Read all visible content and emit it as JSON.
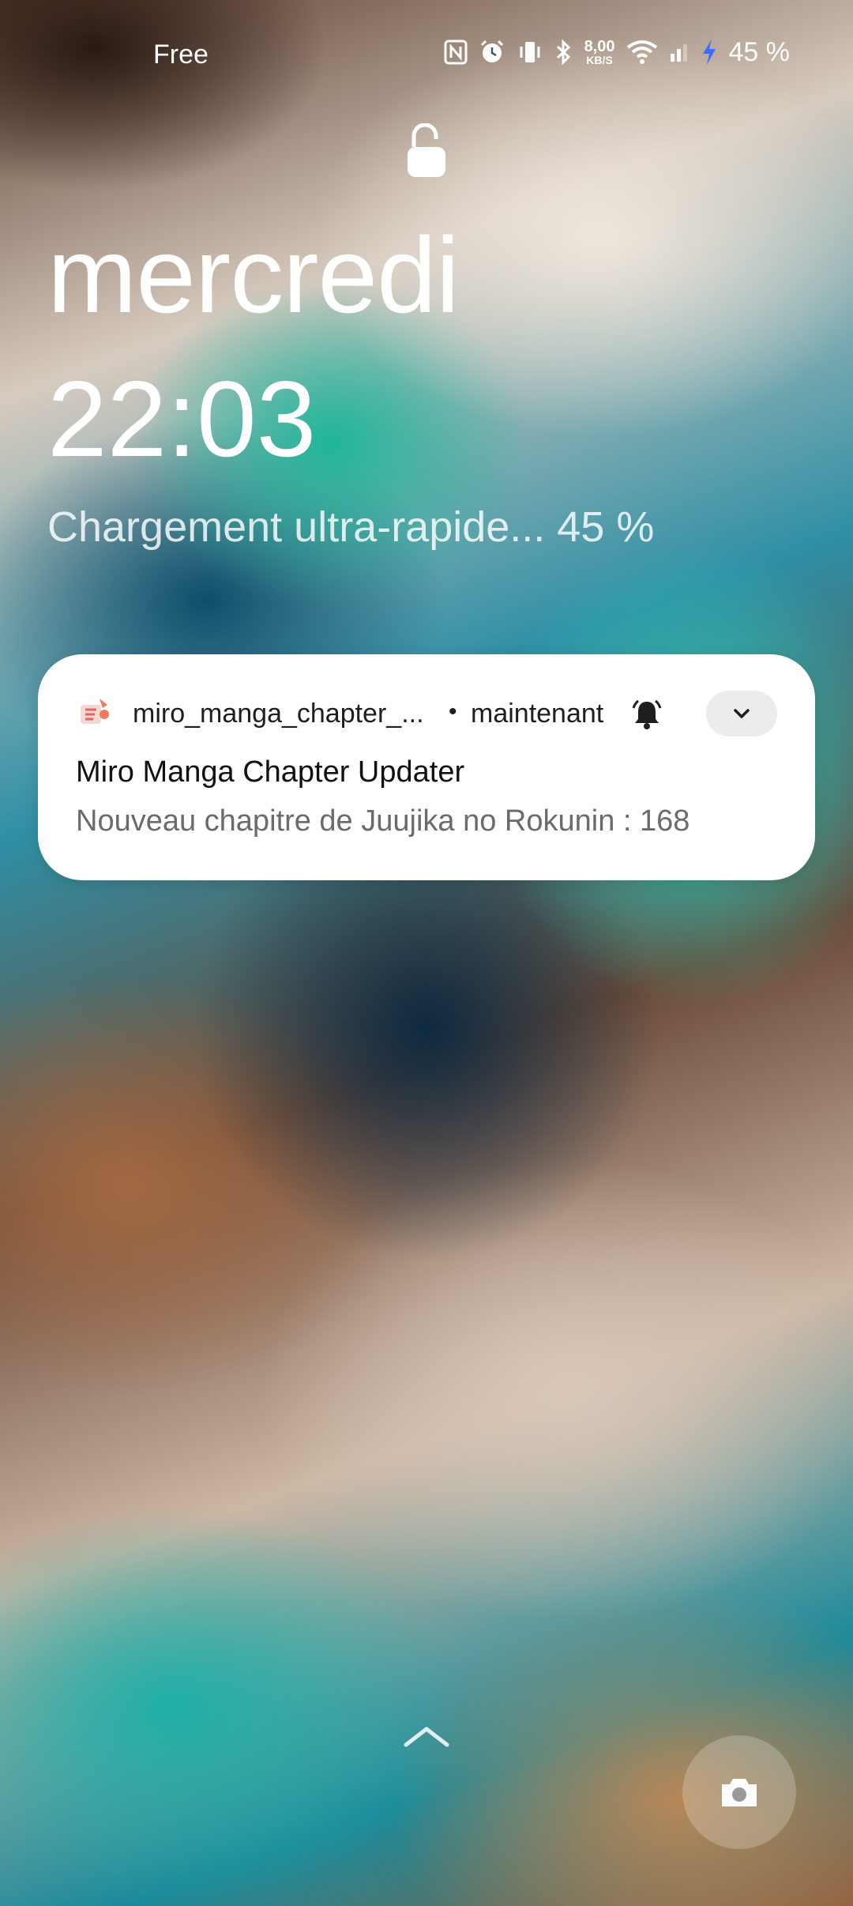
{
  "status_bar": {
    "carrier": "Free",
    "network_speed_value": "8,00",
    "network_speed_unit": "KB/S",
    "battery_percent": "45 %",
    "icons": [
      "nfc-icon",
      "alarm-icon",
      "vibrate-icon",
      "bluetooth-icon",
      "wifi-icon",
      "signal-icon",
      "charging-bolt-icon"
    ]
  },
  "lockscreen": {
    "day": "mercredi",
    "time": "22:03",
    "charging_status": "Chargement ultra-rapide... 45 %"
  },
  "notification": {
    "app_name": "miro_manga_chapter_...",
    "separator": "•",
    "time": "maintenant",
    "title": "Miro Manga Chapter Updater",
    "text": "Nouveau chapitre de Juujika no Rokunin : 168"
  },
  "bottom": {
    "icons": [
      "swipe-up-chevron-icon",
      "camera-icon"
    ]
  }
}
